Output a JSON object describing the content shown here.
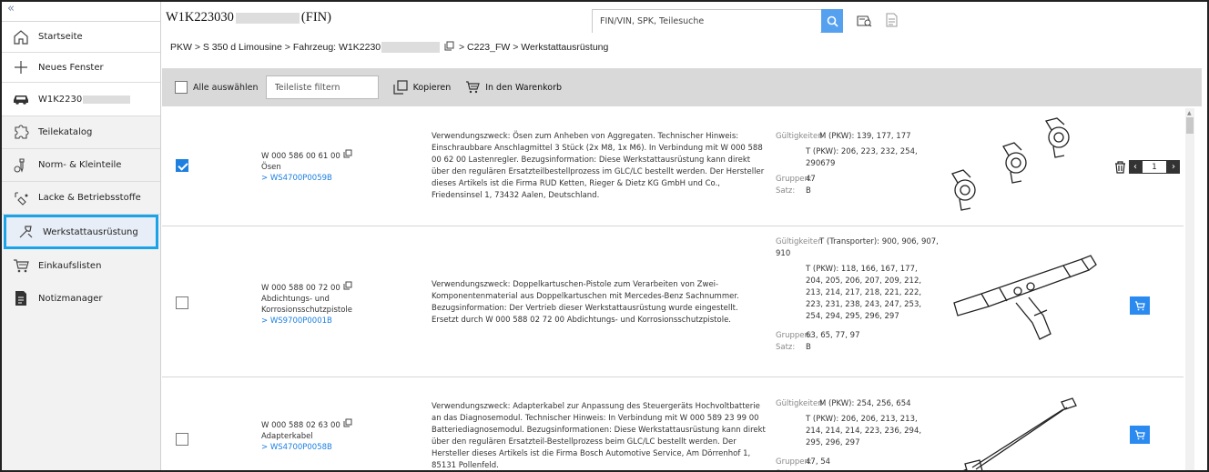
{
  "sidebar": {
    "collapse_glyph": "«",
    "items": [
      {
        "label": "Startseite",
        "icon": "home-icon"
      },
      {
        "label": "Neues Fenster",
        "icon": "plus-icon"
      },
      {
        "label": "W1K2230",
        "icon": "car-icon"
      },
      {
        "label": "Teilekatalog",
        "icon": "puzzle-icon"
      },
      {
        "label": "Norm- & Kleinteile",
        "icon": "screw-icon"
      },
      {
        "label": "Lacke & Betriebsstoffe",
        "icon": "paint-icon"
      },
      {
        "label": "Werkstattausrüstung",
        "icon": "tools-icon"
      },
      {
        "label": "Einkaufslisten",
        "icon": "cart-icon"
      },
      {
        "label": "Notizmanager",
        "icon": "notes-icon"
      }
    ]
  },
  "header": {
    "vin_prefix": "W1K223030",
    "vin_suffix": "(FIN)",
    "search_placeholder": "FIN/VIN, SPK, Teilesuche"
  },
  "breadcrumb": {
    "part1": "PKW > S 350 d Limousine > Fahrzeug: W1K2230",
    "part2": "> C223_FW  > Werkstattausrüstung"
  },
  "toolbar": {
    "select_all": "Alle auswählen",
    "filter_placeholder": "Teileliste filtern",
    "copy": "Kopieren",
    "to_cart": "In den Warenkorb"
  },
  "labels": {
    "gueltigkeiten": "Gültigkeiten",
    "gruppen": "Gruppen:",
    "satz": "Satz:"
  },
  "rows": [
    {
      "checked": true,
      "part_no": "W 000 586 00 61 00",
      "name": "Ösen",
      "link": "> WS4700P0059B",
      "desc": "Verwendungszweck: Ösen zum Anheben von Aggregaten. Technischer Hinweis: Einschraubbare Anschlagmittel 3 Stück (2x M8, 1x M6). In Verbindung mit W   000 588   00   62   00 Lastenregler. Bezugsinformation: Diese Werkstattausrüstung kann direkt über den regulären Ersatzteilbestellprozess im GLC/LC bestellt werden. Der Hersteller dieses Artikels ist die Firma RUD Ketten, Rieger & Dietz KG GmbH und Co., Friedensinsel 1, 73432 Aalen, Deutschland.",
      "valid1": "M (PKW): 139, 177, 177",
      "valid2": "T (PKW): 206, 223, 232, 254, 290679",
      "gruppen": "47",
      "satz": "B",
      "page": "1"
    },
    {
      "checked": false,
      "part_no": "W 000 588 00 72 00",
      "name": "Abdichtungs- und Korrosionsschutzpistole",
      "link": "> WS9700P0001B",
      "desc": "Verwendungszweck: Doppelkartuschen-Pistole zum Verarbeiten von Zwei-Komponentenmaterial aus Doppelkartuschen mit Mercedes-Benz Sachnummer. Bezugsinformation: Der Vertrieb dieser Werkstattausrüstung wurde eingestellt. Ersetzt durch W   000   588   02   72   00 Abdichtungs- und Korrosionsschutzpistole.",
      "valid1": "T (Transporter): 900, 906, 907, 910",
      "valid2": "T (PKW): 118, 166, 167, 177, 204, 205, 206, 207, 209, 212, 213, 214, 217, 218, 221, 222, 223, 231, 238, 243, 247, 253, 254, 294, 295, 296, 297",
      "gruppen": "63, 65, 77, 97",
      "satz": "B"
    },
    {
      "checked": false,
      "part_no": "W 000 588 02 63 00",
      "name": "Adapterkabel",
      "link": "> WS4700P0058B",
      "desc": "Verwendungszweck: Adapterkabel zur Anpassung des Steuergeräts Hochvoltbatterie an das Diagnosemodul. Technischer Hinweis: In Verbindung mit W   000   589   23   99   00 Batteriediagnosemodul. Bezugsinformationen: Diese Werkstattausrüstung kann direkt über den regulären Ersatzteil-Bestellprozess beim GLC/LC bestellt werden. Der Hersteller dieses Artikels ist die Firma Bosch Automotive Service, Am Dörrenhof 1, 85131 Pollenfeld.",
      "valid1": "M (PKW): 254, 256, 654",
      "valid2": "T (PKW): 206, 206, 213, 213, 214, 214, 214, 223, 236, 294, 295, 296, 297",
      "gruppen": "47, 54",
      "satz": ""
    }
  ],
  "colors": {
    "accent": "#2a8af0",
    "active_border": "#1aa3e8",
    "toolbar_bg": "#d9d9d9"
  }
}
